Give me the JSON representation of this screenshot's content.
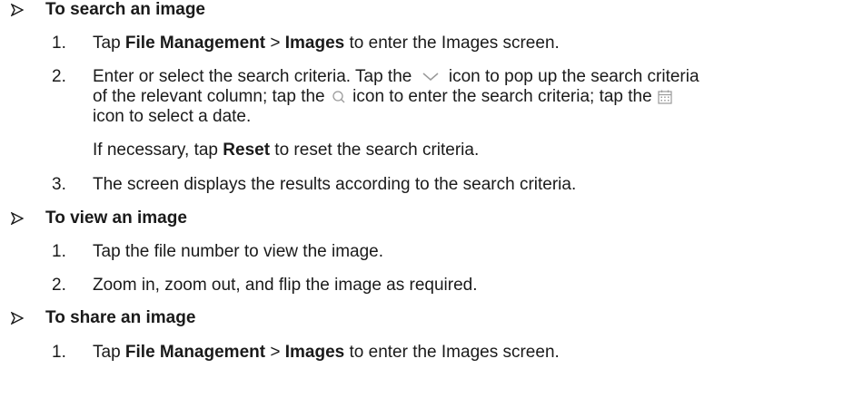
{
  "sections": [
    {
      "title": "To search an image",
      "steps": [
        {
          "number": "1.",
          "parts": [
            "Tap ",
            "File Management",
            " > ",
            "Images",
            " to enter the Images screen."
          ]
        },
        {
          "number": "2.",
          "line1_a": "Enter or select the search criteria. Tap the",
          "line1_b": "icon to pop up the search criteria",
          "line2_a": "of the relevant column; tap the",
          "line2_b": "icon to enter the search criteria; tap the",
          "line3": "icon to select a date.",
          "note_a": "If necessary, tap ",
          "note_bold": "Reset",
          "note_b": " to reset the search criteria."
        },
        {
          "number": "3.",
          "text": "The screen displays the results according to the search criteria."
        }
      ]
    },
    {
      "title": "To view an image",
      "steps": [
        {
          "number": "1.",
          "text": "Tap the file number to view the image."
        },
        {
          "number": "2.",
          "text": "Zoom in, zoom out, and flip the image as required."
        }
      ]
    },
    {
      "title": "To share an image",
      "steps": [
        {
          "number": "1.",
          "parts": [
            "Tap ",
            "File Management",
            " > ",
            "Images",
            " to enter the Images screen."
          ]
        }
      ]
    }
  ],
  "icons": {
    "dropdown": "chevron-down-icon",
    "search": "search-icon",
    "calendar": "calendar-icon"
  },
  "colors": {
    "text": "#1a1a1a",
    "icon": "#9a9a9a"
  }
}
